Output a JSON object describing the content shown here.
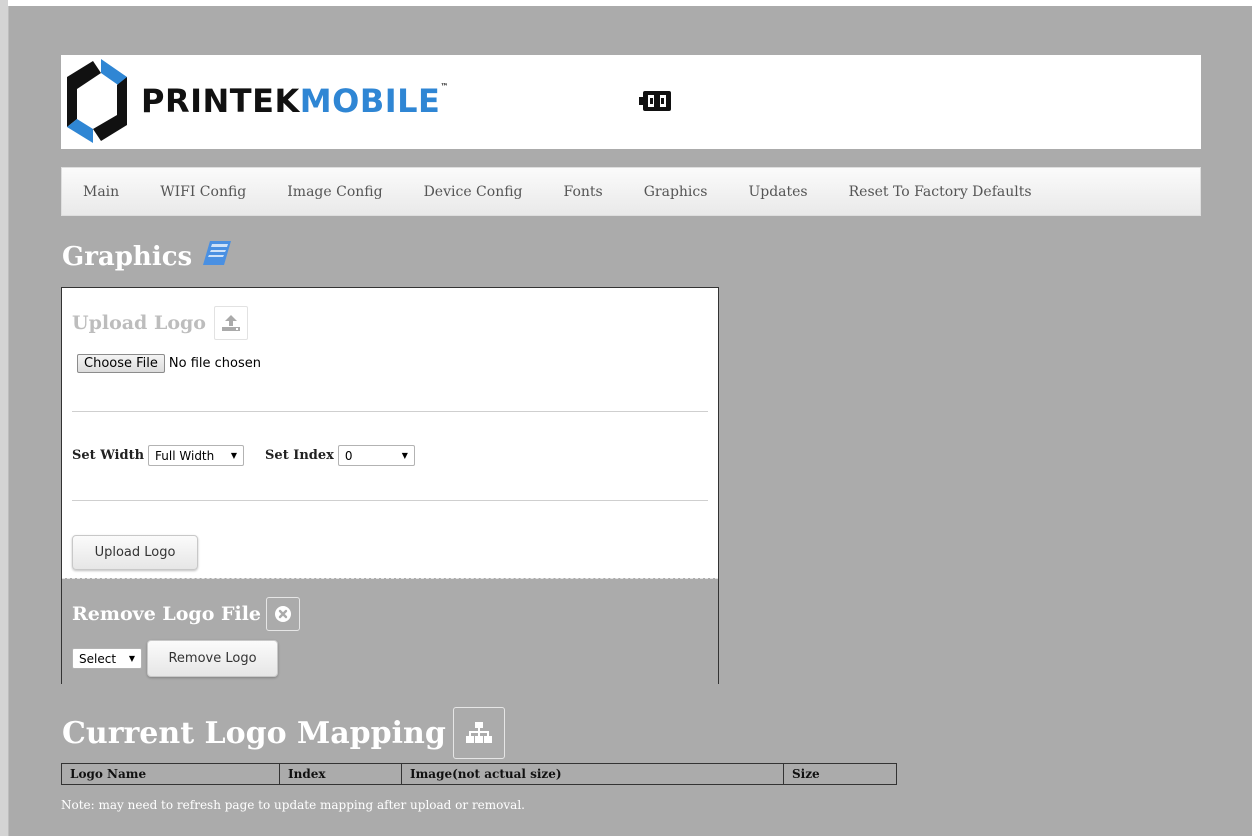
{
  "brand": {
    "part1": "PRINTEK",
    "part2": "MOBILE",
    "tm": "™",
    "color_dark": "#111111",
    "color_blue": "#2f86d4"
  },
  "header": {
    "status_icon": "battery-icon"
  },
  "nav": {
    "items": [
      {
        "label": "Main"
      },
      {
        "label": "WIFI Config"
      },
      {
        "label": "Image Config"
      },
      {
        "label": "Device Config"
      },
      {
        "label": "Fonts"
      },
      {
        "label": "Graphics"
      },
      {
        "label": "Updates"
      },
      {
        "label": "Reset To Factory Defaults"
      }
    ]
  },
  "page": {
    "title": "Graphics",
    "title_icon": "book-icon"
  },
  "upload": {
    "heading": "Upload Logo",
    "heading_icon": "upload-icon",
    "choose_file_label": "Choose File",
    "file_status": "No file chosen",
    "width_label": "Set Width",
    "width_value": "Full Width",
    "index_label": "Set Index",
    "index_value": "0",
    "button_label": "Upload Logo"
  },
  "remove": {
    "heading": "Remove Logo File",
    "heading_icon": "close-circle-icon",
    "select_value": "Select",
    "button_label": "Remove Logo"
  },
  "mapping": {
    "title": "Current Logo Mapping",
    "title_icon": "sitemap-icon",
    "columns": [
      "Logo Name",
      "Index",
      "Image(not actual size)",
      "Size"
    ],
    "note": "Note: may need to refresh page to update mapping after upload or removal."
  },
  "colors": {
    "background": "#ababab",
    "accent": "#2f86d4"
  }
}
